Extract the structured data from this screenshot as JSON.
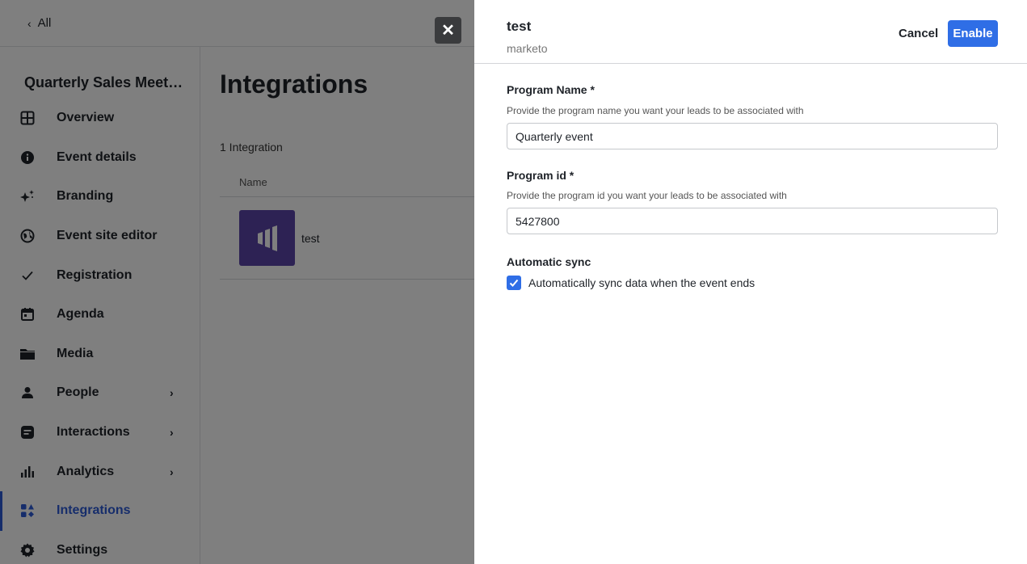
{
  "topbar": {
    "back_label": "All"
  },
  "sidebar": {
    "event_title": "Quarterly Sales Meet…",
    "items": [
      {
        "label": "Overview",
        "icon": "grid-icon"
      },
      {
        "label": "Event details",
        "icon": "info-icon"
      },
      {
        "label": "Branding",
        "icon": "sparkle-icon"
      },
      {
        "label": "Event site editor",
        "icon": "globe-icon"
      },
      {
        "label": "Registration",
        "icon": "check-icon"
      },
      {
        "label": "Agenda",
        "icon": "calendar-icon"
      },
      {
        "label": "Media",
        "icon": "folder-icon"
      },
      {
        "label": "People",
        "icon": "person-icon",
        "arrow": "›"
      },
      {
        "label": "Interactions",
        "icon": "chat-icon",
        "arrow": "›"
      },
      {
        "label": "Analytics",
        "icon": "bar-chart-icon",
        "arrow": "›"
      },
      {
        "label": "Integrations",
        "icon": "shapes-icon",
        "active": true
      },
      {
        "label": "Settings",
        "icon": "gear-icon"
      }
    ]
  },
  "main": {
    "title": "Integrations",
    "count_label": "1 Integration",
    "column_name": "Name",
    "rows": [
      {
        "name": "test",
        "logo": "marketo-logo"
      }
    ]
  },
  "overlay": {
    "close_symbol": "✕"
  },
  "drawer": {
    "title": "test",
    "subtitle": "marketo",
    "cancel_label": "Cancel",
    "enable_label": "Enable",
    "fields": {
      "program_name": {
        "label": "Program Name *",
        "help": "Provide the program name you want your leads to be associated with",
        "value": "Quarterly event"
      },
      "program_id": {
        "label": "Program id *",
        "help": "Provide the program id you want your leads to be associated with",
        "value": "5427800"
      }
    },
    "auto_sync": {
      "label": "Automatic sync",
      "checkbox_label": "Automatically sync data when the event ends",
      "checked": true
    }
  },
  "colors": {
    "accent": "#2f6ee6",
    "active_nav": "#2d5bd6",
    "marketo_logo": "#5a44a8"
  }
}
